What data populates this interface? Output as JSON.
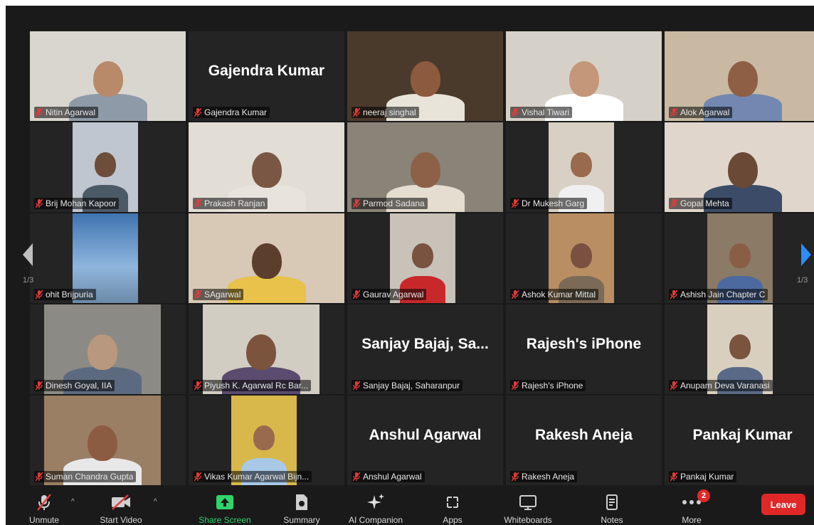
{
  "participants": [
    {
      "name": "Nitin Agarwal",
      "mode": "video",
      "bg": "#d9d6cf",
      "vid": [
        0,
        0,
        219,
        126
      ],
      "skin": "#b88a6a",
      "shirt": "#8e9aa8"
    },
    {
      "name": "Gajendra Kumar",
      "mode": "name"
    },
    {
      "name": "neeraj singhal",
      "mode": "video",
      "bg": "#4a3a2c",
      "vid": [
        0,
        0,
        219,
        126
      ],
      "skin": "#8c5a3c",
      "shirt": "#e9e4da",
      "active": true
    },
    {
      "name": "Vishal Tiwari",
      "mode": "video",
      "bg": "#d6d1c8",
      "vid": [
        0,
        0,
        219,
        126
      ],
      "skin": "#c4977a",
      "shirt": "#ffffff"
    },
    {
      "name": "Alok Agarwal",
      "mode": "video",
      "bg": "#c9b9a2",
      "vid": [
        0,
        0,
        219,
        126
      ],
      "skin": "#8e5f45",
      "shirt": "#7288b0"
    },
    {
      "name": "Brij  Mohan Kapoor",
      "mode": "video",
      "bg": "#bfc6cf",
      "vid": [
        60,
        0,
        92,
        126
      ],
      "skin": "#6d4e3a",
      "shirt": "#4c5a66"
    },
    {
      "name": "Prakash Ranjan",
      "mode": "video",
      "bg": "#e2ddd5",
      "vid": [
        0,
        0,
        219,
        126
      ],
      "skin": "#7a5744",
      "shirt": "#e8e3dc"
    },
    {
      "name": "Parmod Sadana",
      "mode": "video",
      "bg": "#8a8378",
      "vid": [
        0,
        0,
        219,
        126
      ],
      "skin": "#8c6148",
      "shirt": "#e4ddd0"
    },
    {
      "name": "Dr Mukesh Garg",
      "mode": "video",
      "bg": "#d8d0c4",
      "vid": [
        60,
        0,
        92,
        126
      ],
      "skin": "#9a6a4e",
      "shirt": "#f0f0f0"
    },
    {
      "name": "Gopal Mehta",
      "mode": "video",
      "bg": "#e0d6cc",
      "vid": [
        0,
        0,
        219,
        126
      ],
      "skin": "#6a4a36",
      "shirt": "#3c4c68"
    },
    {
      "name": "ohit Brijpuria",
      "mode": "video",
      "bg": "#4d7fb8",
      "vid": [
        60,
        0,
        92,
        126
      ],
      "skin": "",
      "shirt": ""
    },
    {
      "name": "SAgarwal",
      "mode": "video",
      "bg": "#d8c8b6",
      "vid": [
        0,
        0,
        219,
        126
      ],
      "skin": "#5c3e2c",
      "shirt": "#e8c24a"
    },
    {
      "name": "Gaurav Agarwal",
      "mode": "video",
      "bg": "#c8c2b8",
      "vid": [
        60,
        0,
        92,
        126
      ],
      "skin": "#7a5240",
      "shirt": "#c8282a"
    },
    {
      "name": "Ashok Kumar Mittal",
      "mode": "video",
      "bg": "#b88e62",
      "vid": [
        60,
        0,
        92,
        126
      ],
      "skin": "#7a5040",
      "shirt": "#7b6a58"
    },
    {
      "name": "Ashish Jain Chapter C",
      "mode": "video",
      "bg": "#8a7a66",
      "vid": [
        60,
        0,
        92,
        126
      ],
      "skin": "#8a5e46",
      "shirt": "#4c6aa0"
    },
    {
      "name": "Dinesh Goyal, IIA",
      "mode": "video",
      "bg": "#8c8a84",
      "vid": [
        20,
        0,
        164,
        126
      ],
      "skin": "#b8987e",
      "shirt": "#5c6a80"
    },
    {
      "name": "Piyush K. Agarwal Rc Bar...",
      "mode": "video",
      "bg": "#d2cdc2",
      "vid": [
        20,
        0,
        164,
        126
      ],
      "skin": "#7c543e",
      "shirt": "#5a4c6e"
    },
    {
      "name": "Sanjay Bajaj, Saharanpur",
      "mode": "name",
      "big": "Sanjay  Bajaj,  Sa..."
    },
    {
      "name": "Rajesh's iPhone",
      "mode": "name"
    },
    {
      "name": "Anupam Deva Varanasi",
      "mode": "video",
      "bg": "#d8cfbf",
      "vid": [
        60,
        0,
        92,
        126
      ],
      "skin": "#7a543e",
      "shirt": "#5a6a86"
    },
    {
      "name": "Suman Chandra Gupta",
      "mode": "video",
      "bg": "#9a7f64",
      "vid": [
        20,
        0,
        164,
        126
      ],
      "skin": "#8c5c42",
      "shirt": "#e8e8e8"
    },
    {
      "name": "Vikas Kumar Agarwal Bijn...",
      "mode": "video",
      "bg": "#d8b84a",
      "vid": [
        60,
        0,
        92,
        126
      ],
      "skin": "#9a6a4e",
      "shirt": "#a8c8e8"
    },
    {
      "name": "Anshul Agarwal",
      "mode": "name"
    },
    {
      "name": "Rakesh Aneja",
      "mode": "name"
    },
    {
      "name": "Pankaj Kumar",
      "mode": "name"
    }
  ],
  "pagination": {
    "left": "1/3",
    "right": "1/3"
  },
  "toolbar": {
    "unmute": "Unmute",
    "start_video": "Start Video",
    "share_screen": "Share Screen",
    "summary": "Summary",
    "ai_companion": "AI Companion",
    "apps": "Apps",
    "whiteboards": "Whiteboards",
    "notes": "Notes",
    "more": "More",
    "more_badge": "2",
    "leave": "Leave"
  },
  "colors": {
    "active_border": "#c6e04a",
    "share_green": "#2fd46b",
    "leave_red": "#e02828",
    "muted_mic": "#e23b3b"
  }
}
